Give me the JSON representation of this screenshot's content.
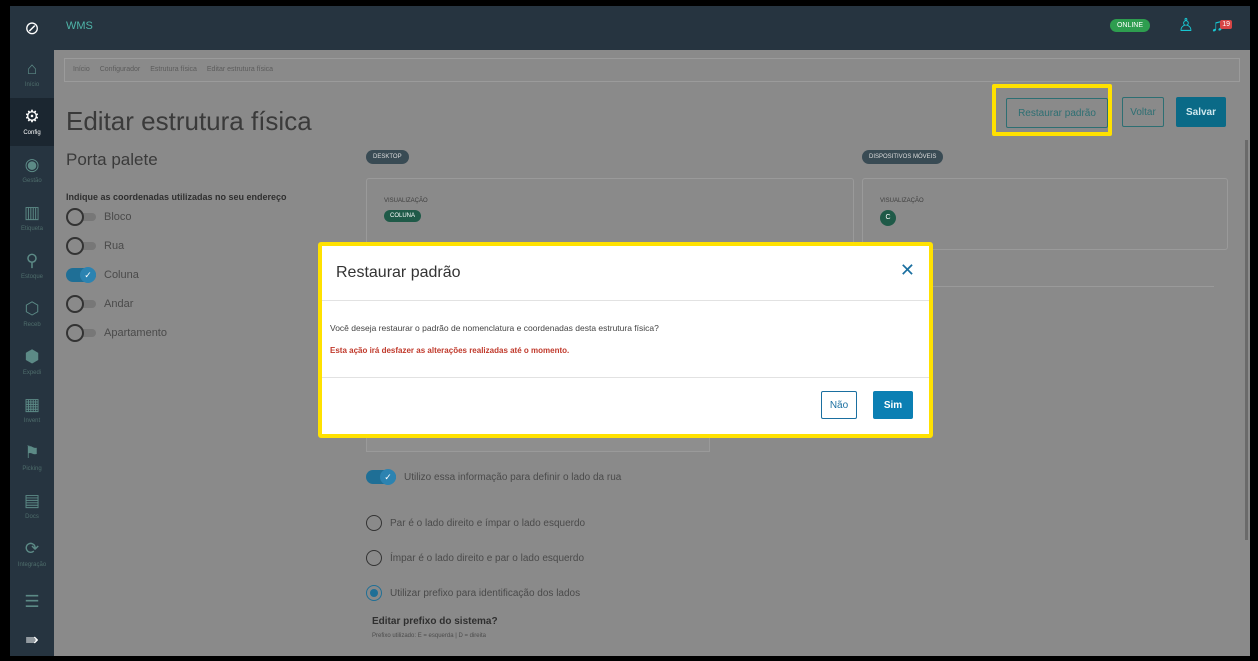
{
  "topbar": {
    "app_name": "WMS",
    "online_label": "ONLINE",
    "notif_count": "19"
  },
  "sidebar": {
    "items": [
      {
        "label": "Início",
        "icon": "home-icon"
      },
      {
        "label": "Config",
        "icon": "gear-icon"
      },
      {
        "label": "Gestão",
        "icon": "location-icon"
      },
      {
        "label": "Etiqueta",
        "icon": "barcode-icon"
      },
      {
        "label": "Estoque",
        "icon": "search-icon"
      },
      {
        "label": "Receb",
        "icon": "box-icon"
      },
      {
        "label": "Expedi",
        "icon": "box-out-icon"
      },
      {
        "label": "Invent",
        "icon": "inventory-icon"
      },
      {
        "label": "Picking",
        "icon": "picking-icon"
      },
      {
        "label": "Docs",
        "icon": "document-icon"
      },
      {
        "label": "Integração",
        "icon": "sync-icon"
      }
    ]
  },
  "breadcrumb": [
    "Início",
    "Configurador",
    "Estrutura física",
    "Editar estrutura física"
  ],
  "page": {
    "title": "Editar estrutura física",
    "restore_label": "Restaurar padrão",
    "back_label": "Voltar",
    "save_label": "Salvar",
    "section_title": "Porta palete",
    "coord_question": "Indique as coordenadas utilizadas no seu endereço",
    "coords": [
      {
        "label": "Bloco",
        "on": false
      },
      {
        "label": "Rua",
        "on": false
      },
      {
        "label": "Coluna",
        "on": true
      },
      {
        "label": "Andar",
        "on": false
      },
      {
        "label": "Apartamento",
        "on": false
      }
    ]
  },
  "desktop": {
    "tag": "DESKTOP",
    "view_label": "VISUALIZAÇÃO",
    "chip": "COLUNA"
  },
  "mobile": {
    "tag": "DISPOSITIVOS MÓVEIS",
    "view_label": "VISUALIZAÇÃO",
    "chip": "C"
  },
  "options": {
    "toggle_label": "Utilizo essa informação para definir o lado da rua",
    "radio1": "Par é o lado direito e ímpar o lado esquerdo",
    "radio2": "Ímpar é o lado direito e par o lado esquerdo",
    "radio3": "Utilizar prefixo para identificação dos lados",
    "edit_question": "Editar prefixo do sistema?",
    "edit_sub": "Prefixo utilizado: E = esquerda | D = direita"
  },
  "modal": {
    "title": "Restaurar padrão",
    "text": "Você deseja restaurar o padrão de nomenclatura e coordenadas desta estrutura física?",
    "warning": "Esta ação irá desfazer as alterações realizadas até o momento.",
    "no_label": "Não",
    "yes_label": "Sim"
  }
}
